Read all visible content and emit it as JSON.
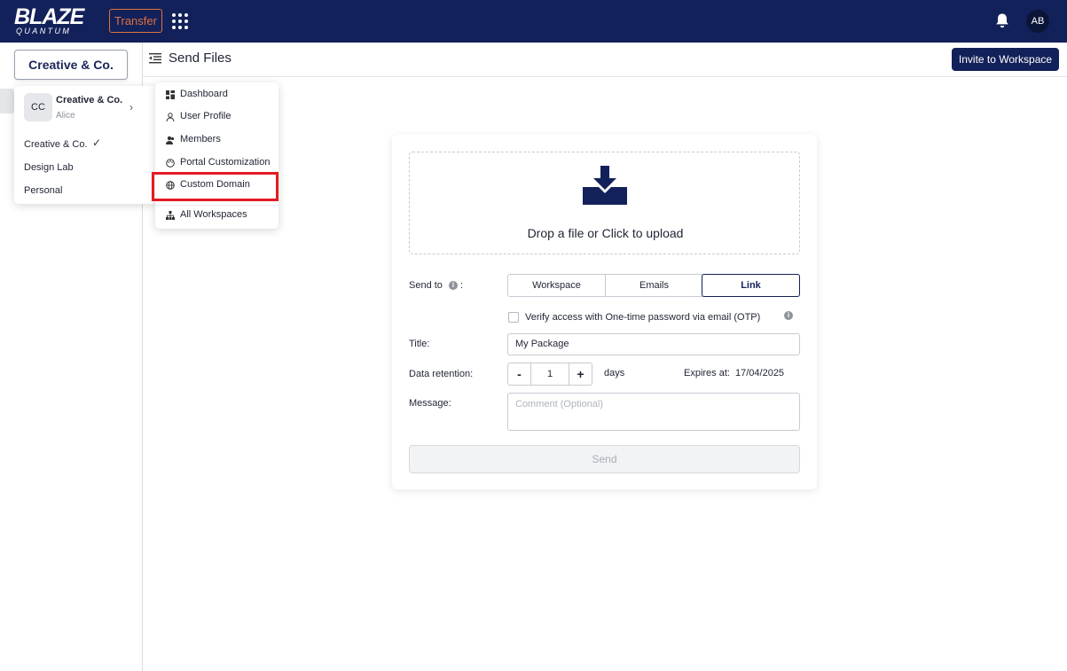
{
  "brand": {
    "logo_main": "BLAZE",
    "logo_sub": "QUANTUM",
    "accent": "#e0703e",
    "navy": "#13215a"
  },
  "topbar": {
    "transfer_label": "Transfer",
    "avatar_initials": "AB"
  },
  "sidebar": {
    "workspace_button": "Creative & Co."
  },
  "header": {
    "title": "Send Files",
    "invite_label": "Invite to Workspace"
  },
  "workspace_menu": {
    "current": {
      "initials": "CC",
      "name": "Creative & Co.",
      "user": "Alice"
    },
    "items": [
      {
        "label": "Creative & Co.",
        "selected": true
      },
      {
        "label": "Design Lab"
      },
      {
        "label": "Personal"
      }
    ]
  },
  "context_menu": {
    "items": [
      {
        "label": "Dashboard",
        "icon": "dashboard-icon"
      },
      {
        "label": "User Profile",
        "icon": "user-icon"
      },
      {
        "label": "Members",
        "icon": "members-icon"
      },
      {
        "label": "Portal Customization",
        "icon": "palette-icon"
      },
      {
        "label": "Custom Domain",
        "icon": "globe-icon",
        "highlighted": true
      },
      {
        "label": "All Workspaces",
        "icon": "hierarchy-icon"
      }
    ]
  },
  "send_form": {
    "drop_text": "Drop a file or Click to upload",
    "send_to_label": "Send to",
    "send_to_colon": ":",
    "send_to_options": [
      "Workspace",
      "Emails",
      "Link"
    ],
    "send_to_selected": "Link",
    "otp_label": "Verify access with One-time password via email (OTP)",
    "title_label": "Title:",
    "title_value": "My Package",
    "retention_label": "Data retention:",
    "retention_value": "1",
    "retention_unit": "days",
    "expires_label": "Expires at:",
    "expires_value": "17/04/2025",
    "message_label": "Message:",
    "message_placeholder": "Comment (Optional)",
    "send_label": "Send"
  }
}
